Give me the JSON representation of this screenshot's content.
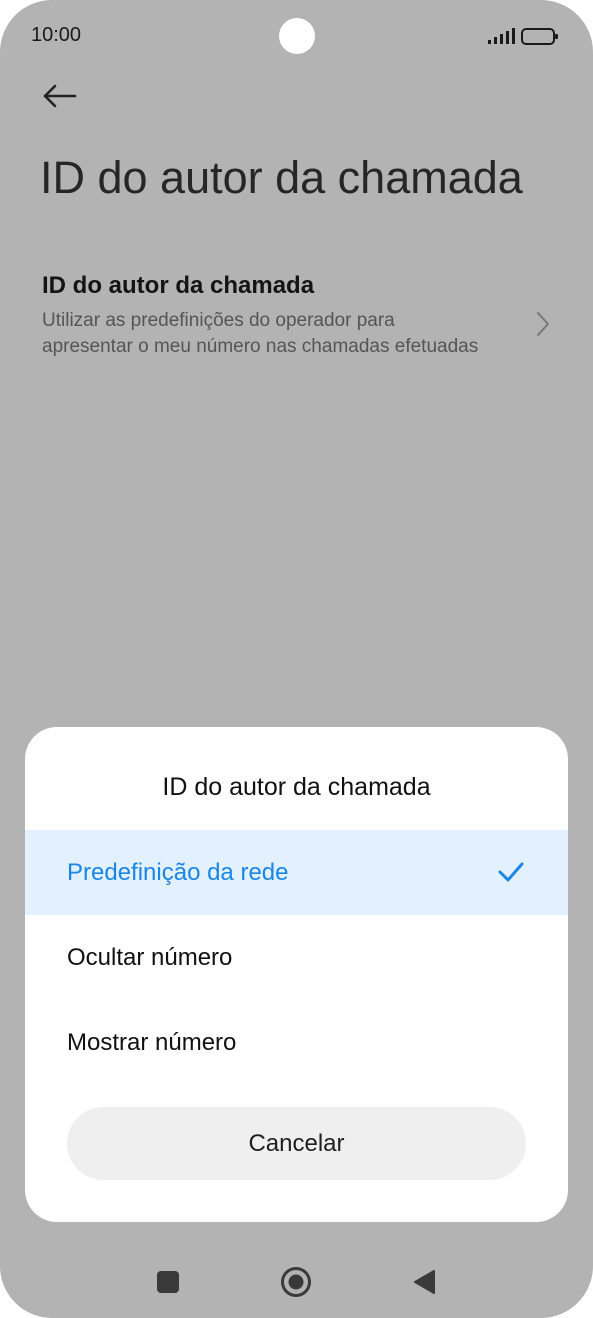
{
  "status_bar": {
    "time": "10:00",
    "icons": [
      "signal-icon",
      "battery-icon"
    ]
  },
  "header": {
    "back_icon": "arrow-left-icon",
    "title": "ID do autor da chamada"
  },
  "setting": {
    "title": "ID do autor da chamada",
    "description": "Utilizar as predefinições do operador para apresentar o meu número nas chamadas efetuadas",
    "icon": "chevron-right-icon"
  },
  "sheet": {
    "title": "ID do autor da chamada",
    "options": [
      {
        "label": "Predefinição da rede",
        "selected": true
      },
      {
        "label": "Ocultar número",
        "selected": false
      },
      {
        "label": "Mostrar número",
        "selected": false
      }
    ],
    "cancel_label": "Cancelar"
  },
  "nav_bar": {
    "icons": [
      "recent-apps-icon",
      "home-icon",
      "back-icon"
    ]
  },
  "colors": {
    "accent": "#1a86e6",
    "selected_bg": "#e3f0fd",
    "scrim": "#b3b3b3"
  }
}
